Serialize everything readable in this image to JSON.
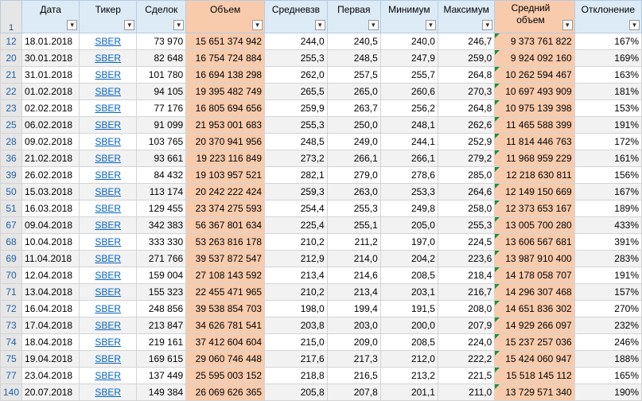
{
  "headers": [
    "Дата",
    "Тикер",
    "Сделок",
    "Объем",
    "Средневзв",
    "Первая",
    "Минимум",
    "Максимум",
    "Средний объем",
    "Отклонение"
  ],
  "header_row_number": "1",
  "filter_icon": "▼",
  "filter_active_icon": "▼",
  "rows": [
    {
      "rn": "12",
      "date": "18.01.2018",
      "ticker": "SBER",
      "deals": "73 970",
      "volume": "15 651 374 942",
      "wavg": "244,0",
      "first": "240,5",
      "min": "240,0",
      "max": "246,7",
      "avgvol": "9 373 761 822",
      "dev": "167%"
    },
    {
      "rn": "20",
      "date": "30.01.2018",
      "ticker": "SBER",
      "deals": "82 648",
      "volume": "16 754 724 884",
      "wavg": "255,3",
      "first": "248,5",
      "min": "247,9",
      "max": "259,0",
      "avgvol": "9 924 092 160",
      "dev": "169%"
    },
    {
      "rn": "21",
      "date": "31.01.2018",
      "ticker": "SBER",
      "deals": "101 780",
      "volume": "16 694 138 298",
      "wavg": "262,0",
      "first": "257,5",
      "min": "255,7",
      "max": "264,8",
      "avgvol": "10 262 594 467",
      "dev": "163%"
    },
    {
      "rn": "22",
      "date": "01.02.2018",
      "ticker": "SBER",
      "deals": "94 105",
      "volume": "19 395 482 749",
      "wavg": "265,5",
      "first": "265,0",
      "min": "260,6",
      "max": "270,3",
      "avgvol": "10 697 493 909",
      "dev": "181%"
    },
    {
      "rn": "23",
      "date": "02.02.2018",
      "ticker": "SBER",
      "deals": "77 176",
      "volume": "16 805 694 656",
      "wavg": "259,9",
      "first": "263,7",
      "min": "256,2",
      "max": "264,8",
      "avgvol": "10 975 139 398",
      "dev": "153%"
    },
    {
      "rn": "25",
      "date": "06.02.2018",
      "ticker": "SBER",
      "deals": "91 099",
      "volume": "21 953 001 683",
      "wavg": "255,3",
      "first": "250,0",
      "min": "248,1",
      "max": "262,6",
      "avgvol": "11 465 588 399",
      "dev": "191%"
    },
    {
      "rn": "28",
      "date": "09.02.2018",
      "ticker": "SBER",
      "deals": "103 765",
      "volume": "20 370 941 956",
      "wavg": "248,5",
      "first": "249,0",
      "min": "244,1",
      "max": "252,9",
      "avgvol": "11 814 446 763",
      "dev": "172%"
    },
    {
      "rn": "36",
      "date": "21.02.2018",
      "ticker": "SBER",
      "deals": "93 661",
      "volume": "19 223 116 849",
      "wavg": "273,2",
      "first": "266,1",
      "min": "266,1",
      "max": "279,2",
      "avgvol": "11 968 959 229",
      "dev": "161%"
    },
    {
      "rn": "39",
      "date": "26.02.2018",
      "ticker": "SBER",
      "deals": "84 432",
      "volume": "19 103 957 521",
      "wavg": "282,1",
      "first": "279,0",
      "min": "278,6",
      "max": "285,0",
      "avgvol": "12 218 630 811",
      "dev": "156%"
    },
    {
      "rn": "50",
      "date": "15.03.2018",
      "ticker": "SBER",
      "deals": "113 174",
      "volume": "20 242 222 424",
      "wavg": "259,3",
      "first": "263,0",
      "min": "253,3",
      "max": "264,6",
      "avgvol": "12 149 150 669",
      "dev": "167%"
    },
    {
      "rn": "51",
      "date": "16.03.2018",
      "ticker": "SBER",
      "deals": "129 455",
      "volume": "23 374 275 593",
      "wavg": "254,4",
      "first": "255,3",
      "min": "249,8",
      "max": "258,0",
      "avgvol": "12 373 653 167",
      "dev": "189%"
    },
    {
      "rn": "67",
      "date": "09.04.2018",
      "ticker": "SBER",
      "deals": "342 383",
      "volume": "56 367 801 634",
      "wavg": "225,4",
      "first": "255,1",
      "min": "205,0",
      "max": "255,3",
      "avgvol": "13 005 700 280",
      "dev": "433%"
    },
    {
      "rn": "68",
      "date": "10.04.2018",
      "ticker": "SBER",
      "deals": "333 330",
      "volume": "53 263 816 178",
      "wavg": "210,2",
      "first": "211,2",
      "min": "197,0",
      "max": "224,5",
      "avgvol": "13 606 567 681",
      "dev": "391%"
    },
    {
      "rn": "69",
      "date": "11.04.2018",
      "ticker": "SBER",
      "deals": "271 766",
      "volume": "39 537 872 547",
      "wavg": "212,9",
      "first": "214,0",
      "min": "204,2",
      "max": "223,6",
      "avgvol": "13 987 910 400",
      "dev": "283%"
    },
    {
      "rn": "70",
      "date": "12.04.2018",
      "ticker": "SBER",
      "deals": "159 004",
      "volume": "27 108 143 592",
      "wavg": "213,4",
      "first": "214,6",
      "min": "208,5",
      "max": "218,4",
      "avgvol": "14 178 058 707",
      "dev": "191%"
    },
    {
      "rn": "71",
      "date": "13.04.2018",
      "ticker": "SBER",
      "deals": "155 323",
      "volume": "22 455 471 965",
      "wavg": "210,2",
      "first": "213,4",
      "min": "203,1",
      "max": "216,7",
      "avgvol": "14 296 307 468",
      "dev": "157%"
    },
    {
      "rn": "72",
      "date": "16.04.2018",
      "ticker": "SBER",
      "deals": "248 856",
      "volume": "39 538 854 703",
      "wavg": "198,0",
      "first": "199,4",
      "min": "191,5",
      "max": "208,0",
      "avgvol": "14 651 836 302",
      "dev": "270%"
    },
    {
      "rn": "73",
      "date": "17.04.2018",
      "ticker": "SBER",
      "deals": "213 847",
      "volume": "34 626 781 541",
      "wavg": "203,8",
      "first": "203,0",
      "min": "200,0",
      "max": "207,9",
      "avgvol": "14 929 266 097",
      "dev": "232%"
    },
    {
      "rn": "74",
      "date": "18.04.2018",
      "ticker": "SBER",
      "deals": "219 161",
      "volume": "37 412 604 604",
      "wavg": "215,0",
      "first": "209,0",
      "min": "208,5",
      "max": "224,0",
      "avgvol": "15 237 257 036",
      "dev": "246%"
    },
    {
      "rn": "75",
      "date": "19.04.2018",
      "ticker": "SBER",
      "deals": "169 615",
      "volume": "29 060 746 448",
      "wavg": "217,6",
      "first": "217,3",
      "min": "212,0",
      "max": "222,2",
      "avgvol": "15 424 060 947",
      "dev": "188%"
    },
    {
      "rn": "77",
      "date": "23.04.2018",
      "ticker": "SBER",
      "deals": "137 449",
      "volume": "25 595 003 152",
      "wavg": "218,8",
      "first": "216,5",
      "min": "213,2",
      "max": "221,5",
      "avgvol": "15 518 145 112",
      "dev": "165%"
    },
    {
      "rn": "140",
      "date": "20.07.2018",
      "ticker": "SBER",
      "deals": "149 384",
      "volume": "26 069 626 365",
      "wavg": "205,8",
      "first": "207,8",
      "min": "201,1",
      "max": "211,0",
      "avgvol": "13 729 571 340",
      "dev": "190%"
    }
  ]
}
